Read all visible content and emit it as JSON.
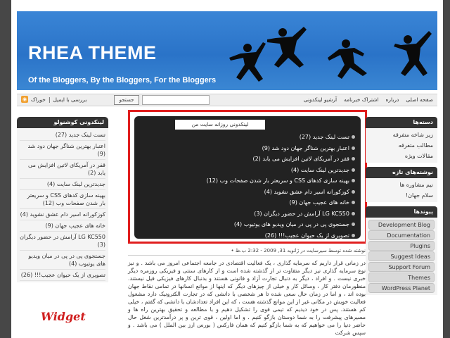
{
  "header": {
    "title": "RHEA THEME",
    "tagline": "Of the Bloggers, By the Bloggers, For the Bloggers"
  },
  "navbar": {
    "feed_label": "خوراک",
    "email_label": "بررسی با ایمیل",
    "search_button": "جستجو",
    "search_value": "",
    "menu": [
      "صفحه اصلی",
      "درباره",
      "اشتراک خبرنامه",
      "آرشیو لینکدونی"
    ]
  },
  "left_sidebar": {
    "title": "لینکدونی کوشنولو",
    "items": [
      "تست لینک جدید (27)",
      "اعتبار بهترین شناگر جهان دود شد (9)",
      "قفر در آمریکای لاتین افزایش می یابد (2)",
      "جدیدترین لینک سایت (4)",
      "بهینه سازی کدهای CSS و سریعتر بار شدن صفحات وب (12)",
      "کوزکورانه اسیر دام عشق نشوید (4)",
      "خانه های عجیب جهان (9)",
      "LG KC550 آرامش در حضور دیگران (3)",
      "جستجوی پی در پی در میان ویدیو های یوتیوب (4)",
      "تصویری از یک حیوان عجیب!!! (26)"
    ]
  },
  "widget_label": "Widget",
  "feed": {
    "tab_label": "لینکدونی روزانه سایت من",
    "items": [
      "تست لینک جدید (27)",
      "اعتبار بهترین شناگر جهان دود شد (9)",
      "قفر در آمریکای لاتین افزایش می یابد (2)",
      "جدیدترین لینک سایت (4)",
      "بهینه سازی کدهای CSS و سریعتر بار شدن صفحات وب (12)",
      "کوزکورانه اسیر دام عشق نشوید (4)",
      "خانه های عجیب جهان (9)",
      "LG KC550 آرامش در حضور دیگران (3)",
      "جستجوی پی در پی در میان ویدیو های یوتیوب (4)",
      "تصویری از یک حیوان عجیب!!! (26)"
    ]
  },
  "post": {
    "meta": "نوشته شده توسط سیرسایت در ژانویه 31, 2009 - 2:32 ب.ظ •",
    "body": "در زمانی قرار داریم که سرمایه گذاری ، یک فعالیت اقتصادی در جامعه اجتماعی امروز می باشد . و نیز نوع سرمایه گذاری نیز دیگر متفاوت تر از گذشته شده است و از کارهای سنتی و فیزیکی روزمره دیگر خبری نیست . و افراد ، دیگر به دنبال تجارت آزاد و قانونی هستند و بدنبال کارهای فیزیکی قیل نیستند. منظورمان دفتر کار ، وسائل کار و خیلی از چیزهای دیگر که اینها از موانع انسانها در تمامی نقاط جهان بوده اند ، و اما در زمان حال سعی شده تا هر شخصی با دانشی که در تجارت الکترونیک دارد مشغول فعالیت خویش در مکانی غیر از این موانع گذشته هست ، که این افراد تعدادشان با دانشی که گفتم ، خیلی کم هستند. پس در خود دیدیم که تیمی قوی را تشکیل دهیم و با مطالعه و تحقیق بهترین راه ها و مسیرهای پیشرفت را به شما دوستان بازگو کنیم . و اما اولین ، قوی ترین و پر درآمدترین شغل حال حاضر دنیا را می خواهیم که به شما بازگو کنیم که همان فارکس ( بورس ارز بین الملل ) می باشد . و سپس شرکت"
  },
  "right_sidebar": {
    "categories_title": "دسته‌ها",
    "categories": [
      "زیر شاخه متفرقه",
      "مطالب متفرقه",
      "مقالات ویژه"
    ],
    "recent_title": "نوشته‌های تازه",
    "recent": [
      "نیم مشاوره ها",
      "سلام جهان!"
    ],
    "links_title": "پیوندها",
    "links": [
      "Development Blog",
      "Documentation",
      "Plugins",
      "Suggest Ideas",
      "Support Forum",
      "Themes",
      "WordPress Planet"
    ]
  }
}
